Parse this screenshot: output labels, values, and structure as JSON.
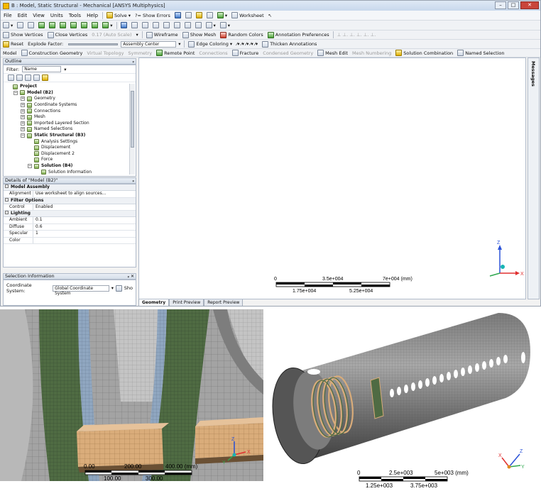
{
  "window": {
    "title": "B : Model, Static Structural - Mechanical [ANSYS Multiphysics]",
    "minimize": "–",
    "maximize": "□",
    "close": "✕"
  },
  "menubar": [
    "File",
    "Edit",
    "View",
    "Units",
    "Tools",
    "Help"
  ],
  "toolbar1": {
    "solve": "Solve",
    "show_errors": "?= Show Errors",
    "worksheet": "Worksheet"
  },
  "toolbar2": {
    "show_vertices": "Show Vertices",
    "close_vertices": "Close Vertices",
    "auto_scale": "0.17 (Auto Scale)",
    "wireframe": "Wireframe",
    "show_mesh": "Show Mesh",
    "random_colors": "Random Colors",
    "annotation_prefs": "Annotation Preferences"
  },
  "toolbar3": {
    "reset": "Reset",
    "explode_factor": "Explode Factor:",
    "assembly_center": "Assembly Center",
    "edge_coloring": "Edge Coloring",
    "thicken_annotations": "Thicken Annotations"
  },
  "toolbar4": {
    "model": "Model",
    "construction_geometry": "Construction Geometry",
    "virtual_topology": "Virtual Topology",
    "symmetry": "Symmetry",
    "remote_point": "Remote Point",
    "connections": "Connections",
    "fracture": "Fracture",
    "condensed_geometry": "Condensed Geometry",
    "mesh_edit": "Mesh Edit",
    "mesh_numbering": "Mesh Numbering",
    "solution_combination": "Solution Combination",
    "named_selection": "Named Selection"
  },
  "outline": {
    "header": "Outline",
    "filter_label": "Filter:",
    "filter_value": "Name",
    "tree": [
      {
        "label": "Project",
        "depth": 0,
        "bold": true,
        "toggle": ""
      },
      {
        "label": "Model (B2)",
        "depth": 1,
        "bold": true,
        "toggle": "−"
      },
      {
        "label": "Geometry",
        "depth": 2,
        "bold": false,
        "toggle": "+"
      },
      {
        "label": "Coordinate Systems",
        "depth": 2,
        "bold": false,
        "toggle": "+"
      },
      {
        "label": "Connections",
        "depth": 2,
        "bold": false,
        "toggle": "+"
      },
      {
        "label": "Mesh",
        "depth": 2,
        "bold": false,
        "toggle": "+"
      },
      {
        "label": "Imported Layered Section",
        "depth": 2,
        "bold": false,
        "toggle": "+"
      },
      {
        "label": "Named Selections",
        "depth": 2,
        "bold": false,
        "toggle": "+"
      },
      {
        "label": "Static Structural (B3)",
        "depth": 2,
        "bold": true,
        "toggle": "−"
      },
      {
        "label": "Analysis Settings",
        "depth": 3,
        "bold": false,
        "toggle": ""
      },
      {
        "label": "Displacement",
        "depth": 3,
        "bold": false,
        "toggle": ""
      },
      {
        "label": "Displacement 2",
        "depth": 3,
        "bold": false,
        "toggle": ""
      },
      {
        "label": "Force",
        "depth": 3,
        "bold": false,
        "toggle": ""
      },
      {
        "label": "Solution (B4)",
        "depth": 3,
        "bold": true,
        "toggle": "−"
      },
      {
        "label": "Solution Information",
        "depth": 4,
        "bold": false,
        "toggle": ""
      }
    ]
  },
  "details": {
    "header": "Details of \"Model (B2)\"",
    "groups": [
      {
        "name": "Model Assembly",
        "rows": [
          {
            "key": "Alignment",
            "value": "Use worksheet to align sources..."
          }
        ]
      },
      {
        "name": "Filter Options",
        "rows": [
          {
            "key": "Control",
            "value": "Enabled"
          }
        ]
      },
      {
        "name": "Lighting",
        "rows": [
          {
            "key": "Ambient",
            "value": "0.1"
          },
          {
            "key": "Diffuse",
            "value": "0.6"
          },
          {
            "key": "Specular",
            "value": "1"
          },
          {
            "key": "Color",
            "value": ""
          }
        ]
      }
    ]
  },
  "selection_info": {
    "header": "Selection Information",
    "coord_label": "Coordinate System:",
    "coord_value": "Global Coordinate System",
    "show": "Sho"
  },
  "graphics": {
    "scale_labels_top": [
      "0",
      "3.5e+004",
      "7e+004 (mm)"
    ],
    "scale_labels_bottom": [
      "1.75e+004",
      "5.25e+004"
    ],
    "axes": {
      "x": "X",
      "y": "Y",
      "z": "Z"
    }
  },
  "messages_tab": "Messages",
  "bottom_tabs": [
    "Geometry",
    "Print Preview",
    "Report Preview"
  ],
  "image_left": {
    "scale_labels_top": [
      "0.00",
      "200.00",
      "400.00 (mm)"
    ],
    "scale_labels_bottom": [
      "100.00",
      "300.00"
    ],
    "axes": {
      "x": "X",
      "y": "Y",
      "z": "Z"
    }
  },
  "image_right": {
    "scale_labels_top": [
      "0",
      "2.5e+003",
      "5e+003 (mm)"
    ],
    "scale_labels_bottom": [
      "1.25e+003",
      "3.75e+003"
    ],
    "axes": {
      "x": "X",
      "y": "Y",
      "z": "Z"
    }
  },
  "colors": {
    "axis_x": "#e03030",
    "axis_y": "#2fa84f",
    "axis_z": "#2a52d8",
    "origin": "#18b4b4",
    "mesh_grey": "#9a9a9a",
    "beam_orange": "#d9ac7a",
    "layer_green": "#5a7a4a"
  }
}
